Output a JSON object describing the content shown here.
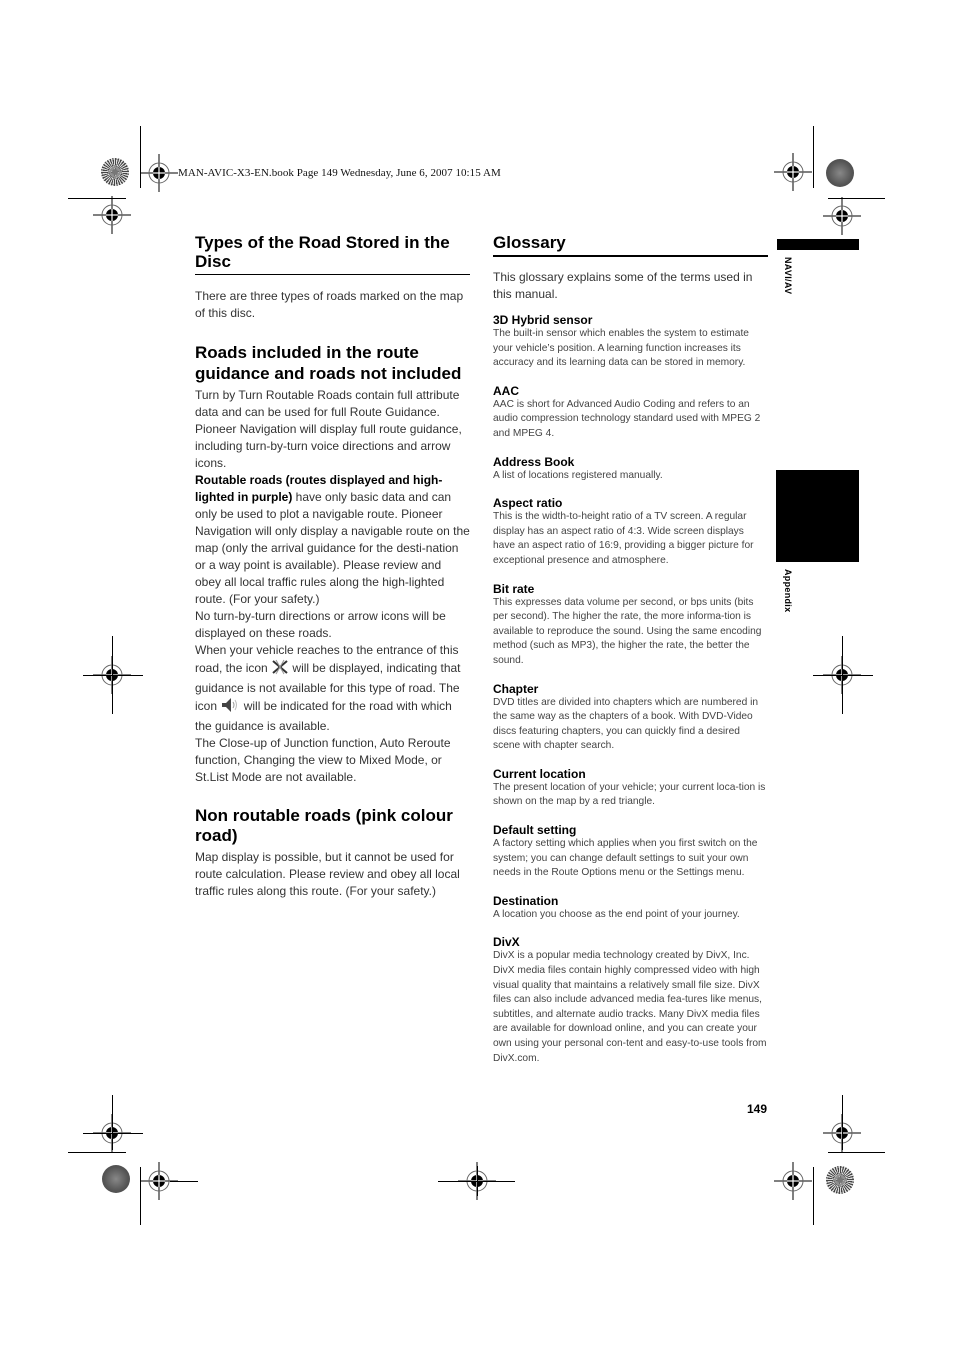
{
  "print_header": "MAN-AVIC-X3-EN.book  Page 149  Wednesday, June 6, 2007  10:15 AM",
  "left": {
    "types": {
      "title": "Types of the Road Stored in the Disc",
      "body": "There are three types of roads marked on the map of this disc."
    },
    "included": {
      "title": "Roads included in the route guidance and roads not included",
      "p1": "Turn by Turn Routable Roads contain full attribute data and can be used for full Route Guidance. Pioneer Navigation will display full route guidance, including turn-by-turn voice directions and arrow icons.",
      "p2_bold": "Routable roads (routes displayed and high-lighted in purple)",
      "p2_rest": " have only basic data and can only be used to plot a navigable route. Pioneer Navigation will only display a navigable route on the map (only the arrival guidance for the desti-nation or a way point is available). Please review and obey all local traffic rules along the high-lighted route. (For your safety.)",
      "p3": "No turn-by-turn directions or arrow icons will be displayed on these roads.",
      "p4_a": "When your vehicle reaches to the entrance of this road, the icon ",
      "p4_icon1": "guidance-unavailable-icon",
      "p4_b": " will be displayed, indicating that guidance is not available for this type of road. The icon ",
      "p4_icon2": "voice-guidance-icon",
      "p4_c": " will be indicated for the road with which the guidance is available.",
      "p5": "The Close-up of Junction function, Auto Reroute function, Changing the view to Mixed Mode, or St.List Mode are not available."
    },
    "non_routable": {
      "title": "Non routable roads (pink colour road)",
      "body": "Map display is possible, but it cannot be used for route calculation. Please review and obey all local traffic rules along this route. (For your safety.)"
    }
  },
  "glossary": {
    "title": "Glossary",
    "intro": "This glossary explains some of the terms used in this manual.",
    "terms": [
      {
        "term": "3D Hybrid sensor",
        "definition": "The built-in sensor which enables the system to estimate your vehicle’s position. A learning function increases its accuracy and its learning data can be stored in memory."
      },
      {
        "term": "AAC",
        "definition": "AAC is short for Advanced Audio Coding and refers to an audio compression technology standard used with MPEG 2 and MPEG 4."
      },
      {
        "term": "Address Book",
        "definition": "A list of locations registered manually."
      },
      {
        "term": "Aspect ratio",
        "definition": "This is the width-to-height ratio of a TV screen. A regular display has an aspect ratio of 4:3. Wide screen displays have an aspect ratio of 16:9, providing a bigger picture for exceptional presence and atmosphere."
      },
      {
        "term": "Bit rate",
        "definition": "This expresses data volume per second, or bps units (bits per second). The higher the rate, the more informa-tion is available to reproduce the sound. Using the same encoding method (such as MP3), the higher the rate, the better the sound."
      },
      {
        "term": "Chapter",
        "definition": "DVD titles are divided into chapters which are numbered in the same way as the chapters of a book. With DVD-Video discs featuring chapters, you can quickly find a desired scene with chapter search."
      },
      {
        "term": "Current location",
        "definition": "The present location of your vehicle; your current loca-tion is shown on the map by a red triangle."
      },
      {
        "term": "Default setting",
        "definition": "A factory setting which applies when you first switch on the system; you can change default settings to suit your own needs in the Route Options menu or the Settings menu."
      },
      {
        "term": "Destination",
        "definition": "A location you choose as the end point of your journey."
      },
      {
        "term": "DivX",
        "definition": "DivX is a popular media technology created by DivX, Inc. DivX media files contain highly compressed video with high visual quality that maintains a relatively small file size. DivX files can also include advanced media fea-tures like menus, subtitles, and alternate audio tracks. Many DivX media files are available for download online, and you can create your own using your personal con-tent and easy-to-use tools from DivX.com."
      }
    ]
  },
  "side_tabs": {
    "top_label": "NAVI/AV",
    "bottom_label": "Appendix"
  },
  "page_number": "149"
}
